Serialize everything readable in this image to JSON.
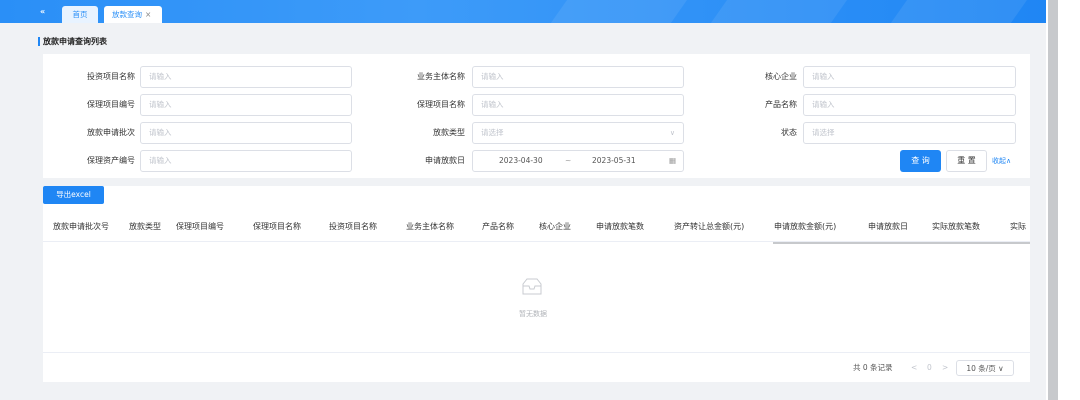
{
  "header": {
    "collapse_glyph": "«",
    "tabs": [
      {
        "label": "首页"
      },
      {
        "label": "放款查询",
        "close": "×"
      }
    ]
  },
  "page": {
    "title": "放款申请查询列表"
  },
  "search": {
    "fields": {
      "invest_project_name": {
        "label": "投资项目名称",
        "placeholder": "请输入"
      },
      "business_entity_name": {
        "label": "业务主体名称",
        "placeholder": "请输入"
      },
      "core_enterprise": {
        "label": "核心企业",
        "placeholder": "请输入"
      },
      "factoring_project_no": {
        "label": "保理项目编号",
        "placeholder": "请输入"
      },
      "factoring_project_name": {
        "label": "保理项目名称",
        "placeholder": "请输入"
      },
      "product_name": {
        "label": "产品名称",
        "placeholder": "请输入"
      },
      "loan_apply_batch": {
        "label": "放款申请批次",
        "placeholder": "请输入"
      },
      "loan_type": {
        "label": "放款类型",
        "placeholder": "请选择"
      },
      "status": {
        "label": "状态",
        "placeholder": "请选择"
      },
      "factoring_asset_no": {
        "label": "保理资产编号",
        "placeholder": "请输入"
      },
      "apply_date": {
        "label": "申请放款日",
        "start": "2023-04-30",
        "sep": "~",
        "end": "2023-05-31"
      }
    },
    "query_label": "查 询",
    "reset_label": "重 置",
    "collapse_label": "收起∧"
  },
  "table": {
    "export_label": "导出excel",
    "columns": [
      "放款申请批次号",
      "放款类型",
      "保理项目编号",
      "保理项目名称",
      "投资项目名称",
      "业务主体名称",
      "产品名称",
      "核心企业",
      "申请放款笔数",
      "资产转让总金额(元)",
      "申请放款金额(元)",
      "申请放款日",
      "实际放款笔数",
      "实际"
    ],
    "rows": [],
    "empty_text": "暂无数据"
  },
  "pagination": {
    "total_text": "共 0 条记录",
    "prev": "<",
    "current_page": "0",
    "next": ">",
    "page_size": "10 条/页 ∨"
  },
  "colors": {
    "primary": "#1f86f4",
    "topbar": "#2a8ff7"
  }
}
